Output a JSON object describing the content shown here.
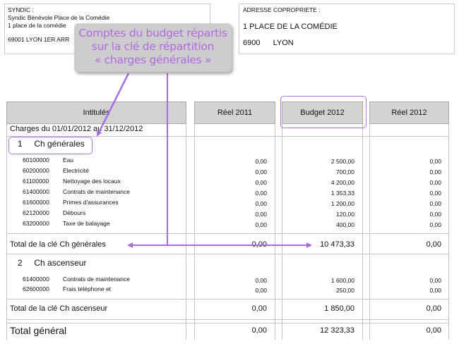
{
  "syndic": {
    "label": "SYNDIC :",
    "name": "Syndic Bénévole Place de la Comédie",
    "address": "1 place de la comédie",
    "city": "69001 LYON 1ER ARR"
  },
  "copropriete": {
    "label": "ADRESSE COPROPRIETE :",
    "address": "1 PLACE DE LA COMÉDIE",
    "postcode": "6900",
    "city": "LYON"
  },
  "annotation": {
    "line1": "Comptes du budget répartis",
    "line2": "sur la clé de répartition",
    "line3": "« charges générales »"
  },
  "columns": {
    "intitules": "Intitulés",
    "reel2011": "Réel 2011",
    "budget2012": "Budget 2012",
    "reel2012": "Réel 2012"
  },
  "period": "Charges du 01/01/2012 au 31/12/2012",
  "groups": [
    {
      "number": "1",
      "title": "Ch générales",
      "lines": [
        {
          "code": "60100000",
          "label": "Eau",
          "reel2011": "0,00",
          "budget2012": "2 500,00",
          "reel2012": "0,00"
        },
        {
          "code": "60200000",
          "label": "Electricité",
          "reel2011": "0,00",
          "budget2012": "700,00",
          "reel2012": "0,00"
        },
        {
          "code": "61100000",
          "label": "Nettoyage des locaux",
          "reel2011": "0,00",
          "budget2012": "4 200,00",
          "reel2012": "0,00"
        },
        {
          "code": "61400000",
          "label": "Contrats de maintenance",
          "reel2011": "0,00",
          "budget2012": "1 353,33",
          "reel2012": "0,00"
        },
        {
          "code": "61600000",
          "label": "Primes d'assurances",
          "reel2011": "0,00",
          "budget2012": "1 200,00",
          "reel2012": "0,00"
        },
        {
          "code": "62120000",
          "label": "Débours",
          "reel2011": "0,00",
          "budget2012": "120,00",
          "reel2012": "0,00"
        },
        {
          "code": "63200000",
          "label": "Taxe de balayage",
          "reel2011": "0,00",
          "budget2012": "400,00",
          "reel2012": "0,00"
        }
      ],
      "total": {
        "label": "Total de la clé Ch générales",
        "reel2011": "0,00",
        "budget2012": "10 473,33",
        "reel2012": "0,00"
      }
    },
    {
      "number": "2",
      "title": "Ch ascenseur",
      "lines": [
        {
          "code": "61400000",
          "label": "Contrats de maintenance",
          "reel2011": "0,00",
          "budget2012": "1 600,00",
          "reel2012": "0,00"
        },
        {
          "code": "62600000",
          "label": "Frais téléphone et",
          "reel2011": "0,00",
          "budget2012": "250,00",
          "reel2012": "0,00"
        }
      ],
      "total": {
        "label": "Total de la clé Ch ascenseur",
        "reel2011": "0,00",
        "budget2012": "1 850,00",
        "reel2012": "0,00"
      }
    }
  ],
  "grand_total": {
    "label": "Total général",
    "reel2011": "0,00",
    "budget2012": "12 323,33",
    "reel2012": "0,00"
  },
  "colors": {
    "annotation": "#b06ae0",
    "highlight": "#b377e4",
    "header_bg": "#d3d3d3"
  }
}
